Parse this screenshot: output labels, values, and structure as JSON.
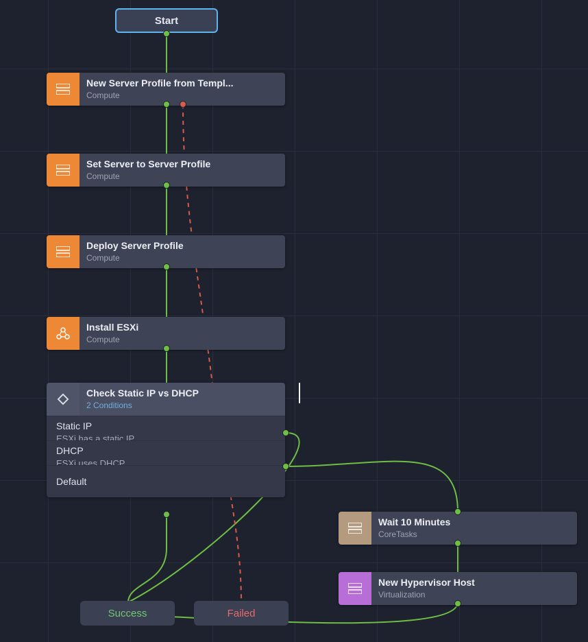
{
  "start": {
    "label": "Start"
  },
  "nodes": {
    "n1": {
      "title": "New Server Profile from Templ...",
      "sub": "Compute"
    },
    "n2": {
      "title": "Set Server to Server Profile",
      "sub": "Compute"
    },
    "n3": {
      "title": "Deploy Server Profile",
      "sub": "Compute"
    },
    "n4": {
      "title": "Install ESXi",
      "sub": "Compute"
    },
    "n5": {
      "title": "Wait 10 Minutes",
      "sub": "CoreTasks"
    },
    "n6": {
      "title": "New Hypervisor Host",
      "sub": "Virtualization"
    }
  },
  "condition": {
    "title": "Check Static IP vs DHCP",
    "sub": "2 Conditions",
    "rows": [
      {
        "label": "Static IP",
        "desc": "ESXi has a static IP"
      },
      {
        "label": "DHCP",
        "desc": "ESXi uses DHCP"
      }
    ],
    "default_label": "Default"
  },
  "end": {
    "success": {
      "label": "Success"
    },
    "failed": {
      "label": "Failed"
    }
  },
  "colors": {
    "green": "#6fbf44",
    "red": "#d95c4a"
  }
}
